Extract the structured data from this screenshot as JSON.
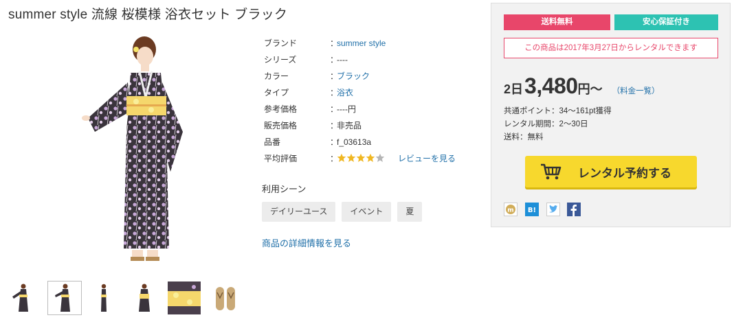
{
  "product": {
    "title": "summer style 流線 桜模様 浴衣セット ブラック"
  },
  "specs": [
    {
      "key": "ブランド",
      "colon": "：",
      "value": "summer style",
      "link": true
    },
    {
      "key": "シリーズ",
      "colon": "：",
      "value": "----",
      "link": false
    },
    {
      "key": "カラー",
      "colon": "：",
      "value": "ブラック",
      "link": true
    },
    {
      "key": "タイプ",
      "colon": "：",
      "value": "浴衣",
      "link": true
    },
    {
      "key": "参考価格",
      "colon": "：",
      "value": "----円",
      "link": false
    },
    {
      "key": "販売価格",
      "colon": "：",
      "value": "非売品",
      "link": false
    },
    {
      "key": "品番",
      "colon": "：",
      "value": "f_03613a",
      "link": false
    },
    {
      "key": "平均評価",
      "colon": "：",
      "rating": 4,
      "rating_max": 5,
      "review_link": "レビューを見る"
    }
  ],
  "scenes": {
    "title": "利用シーン",
    "tags": [
      "デイリーユース",
      "イベント",
      "夏"
    ]
  },
  "details_link": "商品の詳細情報を見る",
  "rental_box": {
    "badge_free": "送料無料",
    "badge_guarantee": "安心保証付き",
    "notice": "この商品は2017年3月27日からレンタルできます",
    "price_days": "2日",
    "price_amount": "3,480",
    "price_unit": "円〜",
    "price_list_link": "（料金一覧）",
    "points": "共通ポイント：34〜161pt獲得",
    "period": "レンタル期間：2〜30日",
    "shipping": "送料：無料",
    "reserve_button": "レンタル予約する"
  },
  "colors": {
    "accent_pink": "#e8466a",
    "accent_teal": "#2dc2b2",
    "cta_yellow": "#f7d82d",
    "link_blue": "#1f6fa8",
    "star_gold": "#f0b722"
  },
  "thumbnails": [
    {
      "icon": "yukata-full-thumb",
      "selected": false
    },
    {
      "icon": "yukata-full-thumb",
      "selected": true
    },
    {
      "icon": "yukata-side-thumb",
      "selected": false
    },
    {
      "icon": "yukata-back-thumb",
      "selected": false
    },
    {
      "icon": "obi-closeup-thumb",
      "selected": false
    },
    {
      "icon": "geta-sandals-thumb",
      "selected": false
    }
  ],
  "share_icons": [
    "mixi-check-icon",
    "hatena-bookmark-icon",
    "twitter-icon",
    "facebook-icon"
  ]
}
